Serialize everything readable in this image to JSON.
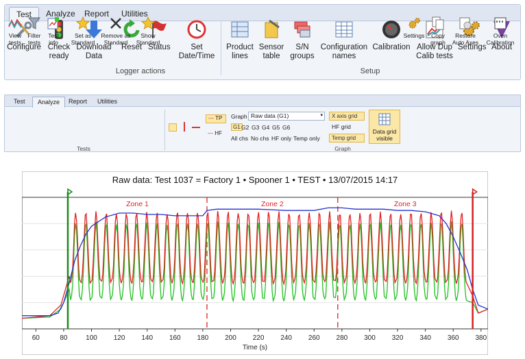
{
  "ribbon1": {
    "tabs": [
      "Test",
      "Analyze",
      "Report",
      "Utilities"
    ],
    "buttons": [
      {
        "label": "Configure",
        "icon": "wrench-screwdriver-icon"
      },
      {
        "label": "Check\nready",
        "icon": "traffic-light-icon"
      },
      {
        "label": "Download\nData",
        "icon": "download-arrow-icon"
      },
      {
        "label": "Reset",
        "icon": "reset-arrow-icon"
      },
      {
        "label": "Status",
        "icon": "flag-icon"
      },
      {
        "label": "Set\nDate/Time",
        "icon": "clock-icon"
      },
      {
        "label": "Product\nlines",
        "icon": "product-lines-icon"
      },
      {
        "label": "Sensor\ntable",
        "icon": "sensor-table-icon"
      },
      {
        "label": "S/N\ngroups",
        "icon": "sn-groups-icon"
      },
      {
        "label": "Configuration\nnames",
        "icon": "configuration-grid-icon"
      },
      {
        "label": "Calibration",
        "icon": "gauge-icon"
      },
      {
        "label": "Allow Dup\nCalib tests",
        "icon": "chart-line-icon"
      },
      {
        "label": "Settings",
        "icon": "gears-icon"
      },
      {
        "label": "About",
        "icon": "about-v-icon"
      }
    ],
    "groups": [
      "Logger actions",
      "Setup"
    ]
  },
  "ribbon2": {
    "tabs": [
      "Test",
      "Analyze",
      "Report",
      "Utilities"
    ],
    "buttons": [
      {
        "label": "View\ntests",
        "icon": "view-tests-icon"
      },
      {
        "label": "Filter\ntests",
        "icon": "filter-icon"
      },
      {
        "label": "Test\ninfo",
        "icon": "test-info-icon"
      },
      {
        "label": "Set as\nStandard",
        "icon": "star-icon"
      },
      {
        "label": "Remove as\nStandard",
        "icon": "remove-x-icon"
      },
      {
        "label": "Show\nStandard",
        "icon": "star-icon"
      },
      {
        "label": "Data grid\nvisible",
        "icon": "data-grid-icon"
      },
      {
        "label": "Settings",
        "icon": "gears-icon"
      },
      {
        "label": "Copy\ngraph",
        "icon": "copy-icon"
      },
      {
        "label": "Restore\nAuto Axes",
        "icon": "restore-axes-icon"
      },
      {
        "label": "Oven\nCalibration",
        "icon": "oven-icon"
      }
    ],
    "group_tests": "Tests",
    "group_graph": "Graph",
    "graph_label": "Graph",
    "graph_select": "Raw data (G1)",
    "channels": [
      "G1",
      "G2",
      "G3",
      "G4",
      "G5",
      "G6"
    ],
    "channel_options": [
      "All chs",
      "No chs",
      "HF only",
      "Temp only"
    ],
    "toggles": [
      "X axis grid",
      "HF grid",
      "Temp grid"
    ],
    "legend_tp": "TP",
    "legend_hf": "HF"
  },
  "chart": {
    "title": "Raw data: Test 1037 = Factory 1 • Spooner 1 • TEST • 13/07/2015 14:17",
    "xlabel": "Time (s)"
  },
  "chart_data": {
    "type": "line",
    "title": "Raw data: Test 1037 = Factory 1 • Spooner 1 • TEST • 13/07/2015 14:17",
    "xlabel": "Time (s)",
    "ylabel": "",
    "xlim": [
      50,
      385
    ],
    "xticks": [
      60,
      80,
      100,
      120,
      140,
      160,
      180,
      200,
      220,
      240,
      260,
      280,
      300,
      320,
      340,
      360,
      380
    ],
    "ylim": [
      0,
      100
    ],
    "markers": [
      {
        "x": 83,
        "color": "#1a8a1a"
      },
      {
        "x": 374,
        "color": "#d22222"
      }
    ],
    "zones": [
      {
        "name": "Zone 1",
        "start": 83,
        "end": 183
      },
      {
        "name": "Zone 2",
        "start": 183,
        "end": 277
      },
      {
        "name": "Zone 3",
        "start": 277,
        "end": 374
      }
    ],
    "series": [
      {
        "color": "#2030d0",
        "x": [
          50,
          70,
          76,
          80,
          84,
          88,
          92,
          96,
          100,
          110,
          120,
          130,
          140,
          150,
          160,
          170,
          180,
          183,
          190,
          200,
          220,
          240,
          260,
          270,
          280,
          290,
          300,
          310,
          320,
          330,
          340,
          350,
          355,
          360,
          365,
          370,
          374,
          378,
          385
        ],
        "y": [
          10,
          10,
          12,
          20,
          35,
          52,
          63,
          72,
          78,
          85,
          88,
          88,
          87,
          87,
          86,
          86,
          86,
          90,
          91,
          91,
          91,
          90,
          90,
          92,
          92,
          91,
          91,
          91,
          90,
          90,
          89,
          86,
          80,
          70,
          58,
          45,
          30,
          18,
          15
        ]
      },
      {
        "color": "#e02020",
        "cycle": {
          "start": 85,
          "end": 370,
          "period": 7.3,
          "peak": 88,
          "trough": 35
        },
        "x": [
          50,
          70,
          78,
          84,
          370,
          374,
          378,
          385
        ],
        "y": [
          8,
          10,
          18,
          40,
          40,
          25,
          12,
          15
        ]
      },
      {
        "color": "#20c020",
        "cycle": {
          "start": 85,
          "end": 370,
          "period": 7.3,
          "peak": 80,
          "trough": 22
        },
        "x": [
          50,
          70,
          78,
          84,
          370,
          374,
          378,
          385
        ],
        "y": [
          8,
          9,
          15,
          30,
          30,
          20,
          12,
          15
        ]
      }
    ]
  }
}
